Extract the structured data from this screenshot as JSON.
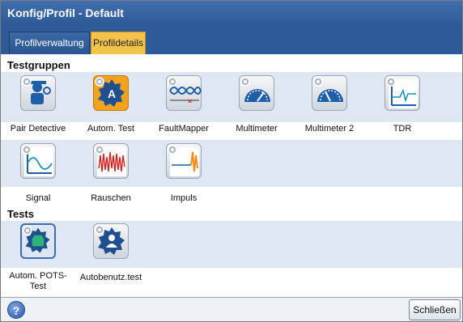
{
  "window": {
    "title": "Konfig/Profil - Default"
  },
  "tabs": [
    {
      "label": "Profilverwaltung"
    },
    {
      "label": "Profildetails"
    }
  ],
  "testgruppen": {
    "header": "Testgruppen",
    "items": [
      {
        "label": "Pair Detective",
        "icon": "pair-detective-icon"
      },
      {
        "label": "Autom. Test",
        "icon": "autotest-icon"
      },
      {
        "label": "FaultMapper",
        "icon": "faultmapper-icon"
      },
      {
        "label": "Multimeter",
        "icon": "multimeter-icon"
      },
      {
        "label": "Multimeter 2",
        "icon": "multimeter-icon"
      },
      {
        "label": "TDR",
        "icon": "tdr-icon"
      },
      {
        "label": "Signal",
        "icon": "signal-icon"
      },
      {
        "label": "Rauschen",
        "icon": "noise-icon"
      },
      {
        "label": "Impuls",
        "icon": "impulse-icon"
      }
    ]
  },
  "tests": {
    "header": "Tests",
    "items": [
      {
        "label": "Autom. POTS-\nTest",
        "icon": "pots-test-icon"
      },
      {
        "label": "Autobenutz.test",
        "icon": "user-test-icon"
      }
    ]
  },
  "footer": {
    "help_label": "?",
    "close_label": "Schließen"
  },
  "colors": {
    "accent": "#f4c34c",
    "titlebar": "#2e5a97",
    "band": "#dfe7f2"
  }
}
